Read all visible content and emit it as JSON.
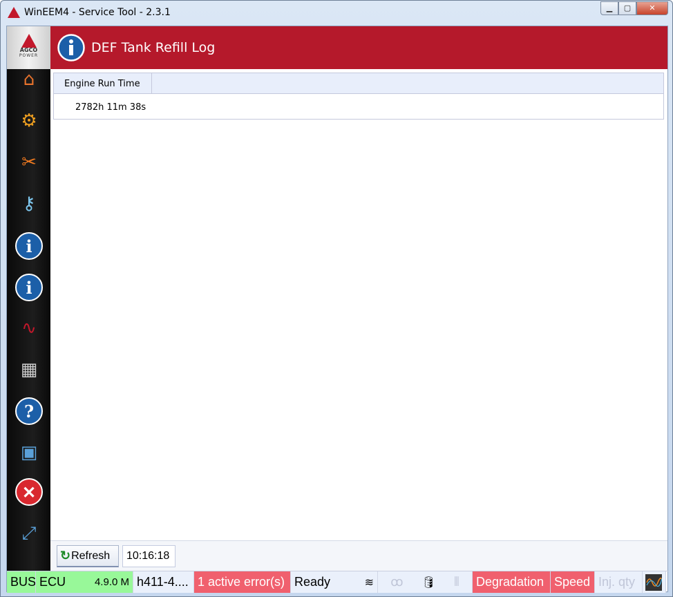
{
  "window": {
    "title": "WinEEM4 - Service Tool - 2.3.1",
    "minimize": "▁",
    "maximize": "▢",
    "close": "✕"
  },
  "brand": {
    "line1": "AGCO",
    "line2": "POWER"
  },
  "sidebar": {
    "items": [
      {
        "name": "home",
        "glyph": "⌂",
        "color": "#e8732c"
      },
      {
        "name": "settings",
        "glyph": "⚙",
        "color": "#f0a020"
      },
      {
        "name": "tools",
        "glyph": "✂",
        "color": "#f07a20"
      },
      {
        "name": "key",
        "glyph": "⚷",
        "color": "#7ec8f0"
      },
      {
        "name": "info",
        "glyph": "i",
        "color": "#1c5fa8"
      },
      {
        "name": "info-settings",
        "glyph": "i",
        "color": "#1c5fa8"
      },
      {
        "name": "signal",
        "glyph": "∿",
        "color": "#c2182b"
      },
      {
        "name": "binary",
        "glyph": "▦",
        "color": "#cccccc"
      },
      {
        "name": "help",
        "glyph": "?",
        "color": "#1c5fa8"
      },
      {
        "name": "save",
        "glyph": "▣",
        "color": "#5aa0d8"
      },
      {
        "name": "exit",
        "glyph": "✕",
        "color": "#d9282f"
      },
      {
        "name": "fullscreen",
        "glyph": "⤢",
        "color": "#5aa0d8"
      }
    ]
  },
  "header": {
    "title": "DEF Tank Refill Log",
    "accent": "#b5192b"
  },
  "table": {
    "columns": [
      "Engine Run Time"
    ],
    "rows": [
      [
        "2782h 11m 38s"
      ]
    ]
  },
  "toolbar": {
    "refresh_label": "Refresh",
    "time": "10:16:18"
  },
  "statusbar": {
    "bus": "BUS",
    "ecu": "ECU",
    "ecu_version": "4.9.0 M",
    "file": "h411-4....",
    "errors": "1 active error(s)",
    "state": "Ready",
    "degradation": "Degradation",
    "speed": "Speed",
    "inj_qty": "Inj. qty"
  }
}
